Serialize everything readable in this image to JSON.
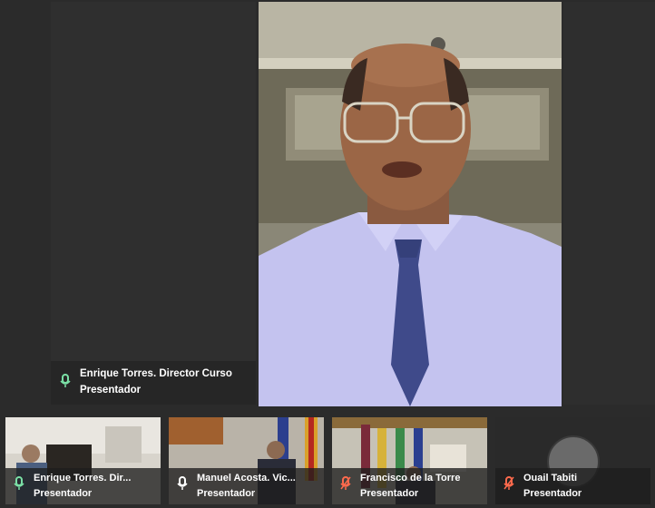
{
  "main_speaker": {
    "name": "Enrique Torres. Director Curso",
    "role": "Presentador",
    "mic_color": "#7be0a6"
  },
  "participants": [
    {
      "name": "Enrique Torres. Dir...",
      "role": "Presentador",
      "mic_icon": "mic-icon",
      "mic_color": "#7be0a6"
    },
    {
      "name": "Manuel Acosta. Vic...",
      "role": "Presentador",
      "mic_icon": "mic-icon",
      "mic_color": "#ffffff"
    },
    {
      "name": "Francisco de la Torre",
      "role": "Presentador",
      "mic_icon": "mic-muted-icon",
      "mic_color": "#ff6a4d"
    },
    {
      "name": "Ouail Tabiti",
      "role": "Presentador",
      "mic_icon": "mic-muted-icon",
      "mic_color": "#ff6a4d"
    }
  ],
  "colors": {
    "background": "#2b2b2b",
    "tile": "#2f2f2f",
    "mic_active": "#7be0a6",
    "mic_muted": "#ff6a4d"
  }
}
